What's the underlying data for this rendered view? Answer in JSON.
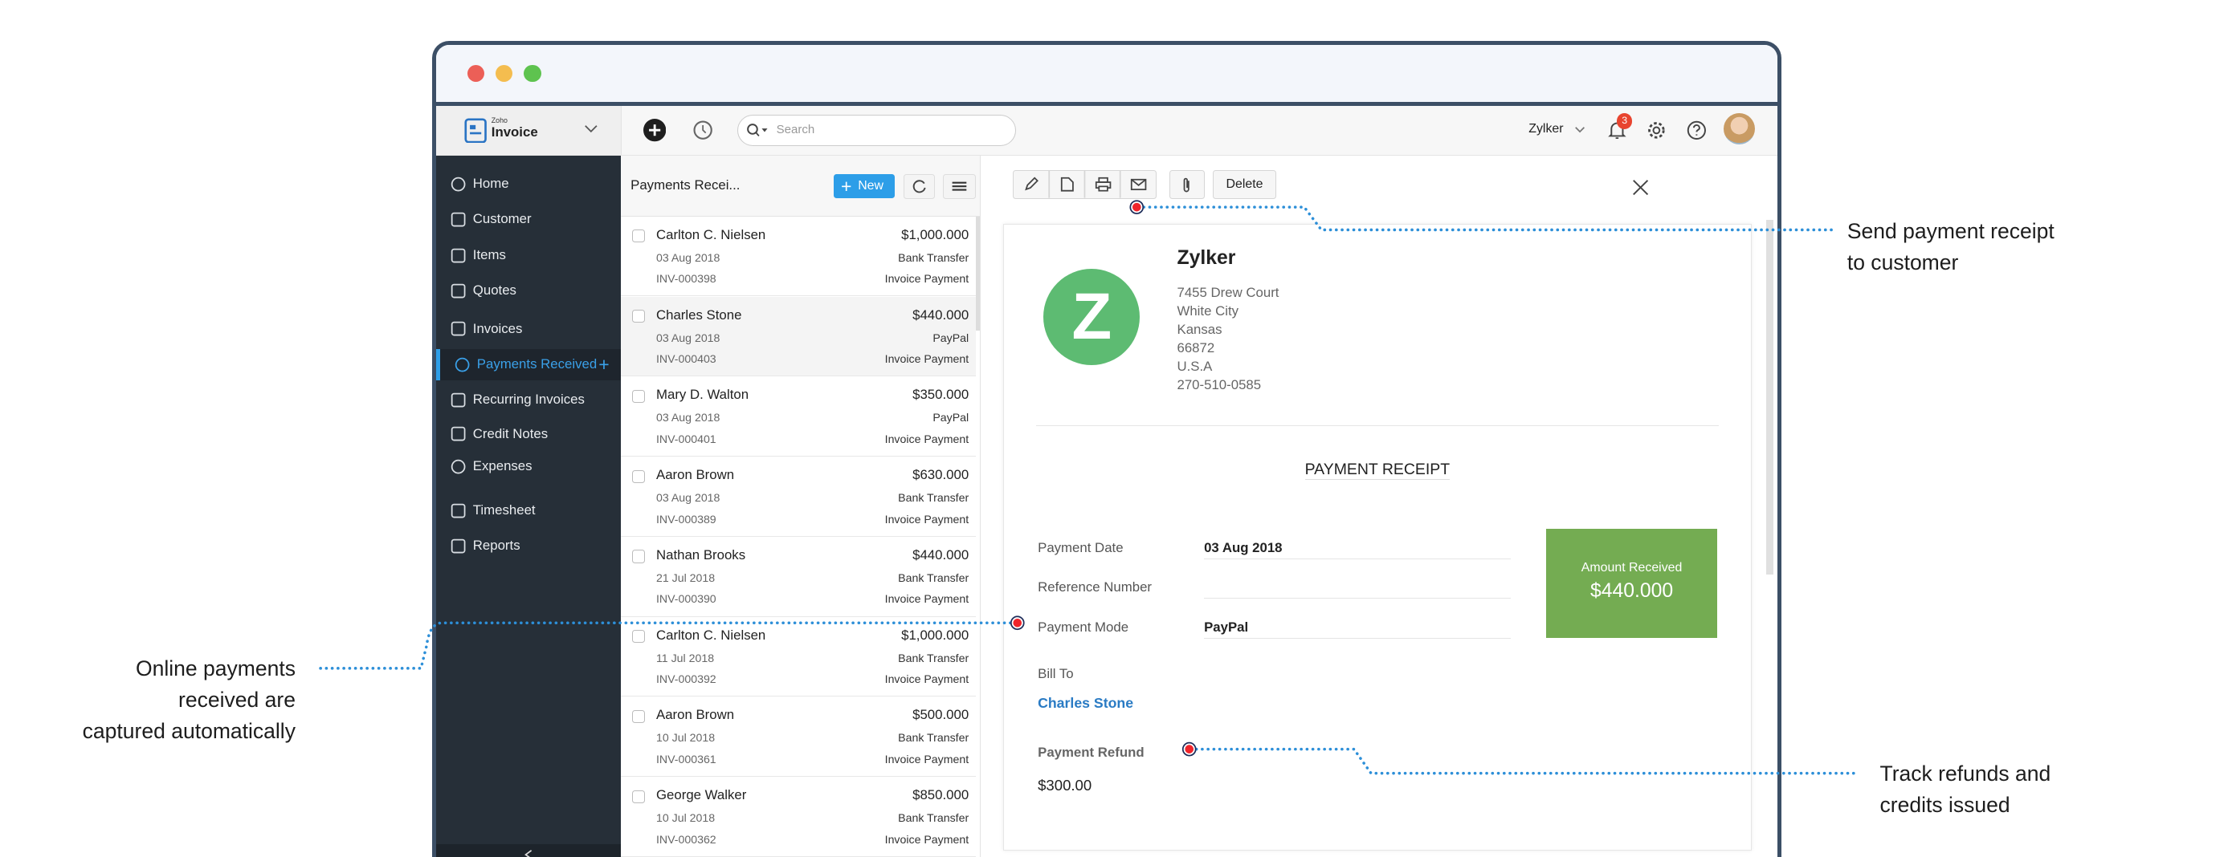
{
  "app": {
    "brand_small": "Zoho",
    "brand": "Invoice",
    "search_placeholder": "Search",
    "org": "Zylker",
    "notif_count": "3"
  },
  "sidebar": {
    "items": [
      {
        "label": "Home",
        "icon": "dashboard-icon"
      },
      {
        "label": "Customer",
        "icon": "user-icon"
      },
      {
        "label": "Items",
        "icon": "basket-icon"
      },
      {
        "label": "Quotes",
        "icon": "quote-icon"
      },
      {
        "label": "Invoices",
        "icon": "document-icon"
      },
      {
        "label": "Payments Received",
        "icon": "payment-icon",
        "active": true
      },
      {
        "label": "Recurring Invoices",
        "icon": "recurring-icon"
      },
      {
        "label": "Credit Notes",
        "icon": "credit-note-icon"
      },
      {
        "label": "Expenses",
        "icon": "dollar-icon"
      },
      {
        "label": "Timesheet",
        "icon": "calendar-icon"
      },
      {
        "label": "Reports",
        "icon": "chart-icon"
      }
    ]
  },
  "list": {
    "title": "Payments Recei...",
    "new_label": "New",
    "rows": [
      {
        "name": "Carlton C. Nielsen",
        "date": "03 Aug 2018",
        "invoice": "INV-000398",
        "amount": "$1,000.000",
        "mode": "Bank Transfer",
        "type": "Invoice Payment"
      },
      {
        "name": "Charles Stone",
        "date": "03 Aug 2018",
        "invoice": "INV-000403",
        "amount": "$440.000",
        "mode": "PayPal",
        "type": "Invoice Payment"
      },
      {
        "name": "Mary D. Walton",
        "date": "03 Aug 2018",
        "invoice": "INV-000401",
        "amount": "$350.000",
        "mode": "PayPal",
        "type": "Invoice Payment"
      },
      {
        "name": "Aaron Brown",
        "date": "03 Aug 2018",
        "invoice": "INV-000389",
        "amount": "$630.000",
        "mode": "Bank Transfer",
        "type": "Invoice Payment"
      },
      {
        "name": "Nathan Brooks",
        "date": "21 Jul 2018",
        "invoice": "INV-000390",
        "amount": "$440.000",
        "mode": "Bank Transfer",
        "type": "Invoice Payment"
      },
      {
        "name": "Carlton C. Nielsen",
        "date": "11 Jul 2018",
        "invoice": "INV-000392",
        "amount": "$1,000.000",
        "mode": "Bank Transfer",
        "type": "Invoice Payment"
      },
      {
        "name": "Aaron Brown",
        "date": "10 Jul 2018",
        "invoice": "INV-000361",
        "amount": "$500.000",
        "mode": "Bank Transfer",
        "type": "Invoice Payment"
      },
      {
        "name": "George Walker",
        "date": "10 Jul 2018",
        "invoice": "INV-000362",
        "amount": "$850.000",
        "mode": "Bank Transfer",
        "type": "Invoice Payment"
      }
    ]
  },
  "detail": {
    "delete_label": "Delete",
    "company": {
      "name": "Zylker",
      "logo_letter": "Z",
      "address": [
        "7455 Drew Court",
        "White City",
        "Kansas",
        "66872",
        "U.S.A",
        "270-510-0585"
      ]
    },
    "receipt_title": "PAYMENT RECEIPT",
    "fields": [
      {
        "label": "Payment Date",
        "value": "03 Aug 2018"
      },
      {
        "label": "Reference Number",
        "value": ""
      },
      {
        "label": "Payment Mode",
        "value": "PayPal"
      }
    ],
    "amount_label": "Amount Received",
    "amount": "$440.000",
    "bill_to_label": "Bill To",
    "bill_to": "Charles Stone",
    "refund_label": "Payment Refund",
    "refund": "$300.00"
  },
  "annotations": {
    "send": [
      "Send payment receipt",
      "to customer"
    ],
    "online": [
      "Online payments",
      "received are",
      "captured automatically"
    ],
    "refunds": [
      "Track refunds and",
      "credits issued"
    ]
  },
  "colors": {
    "accent": "#2d9ee8",
    "sidebar": "#262f38",
    "green": "#74ac52",
    "logo": "#5dbb72",
    "frame": "#3c4f66",
    "annotation": "#2d8fd8"
  }
}
